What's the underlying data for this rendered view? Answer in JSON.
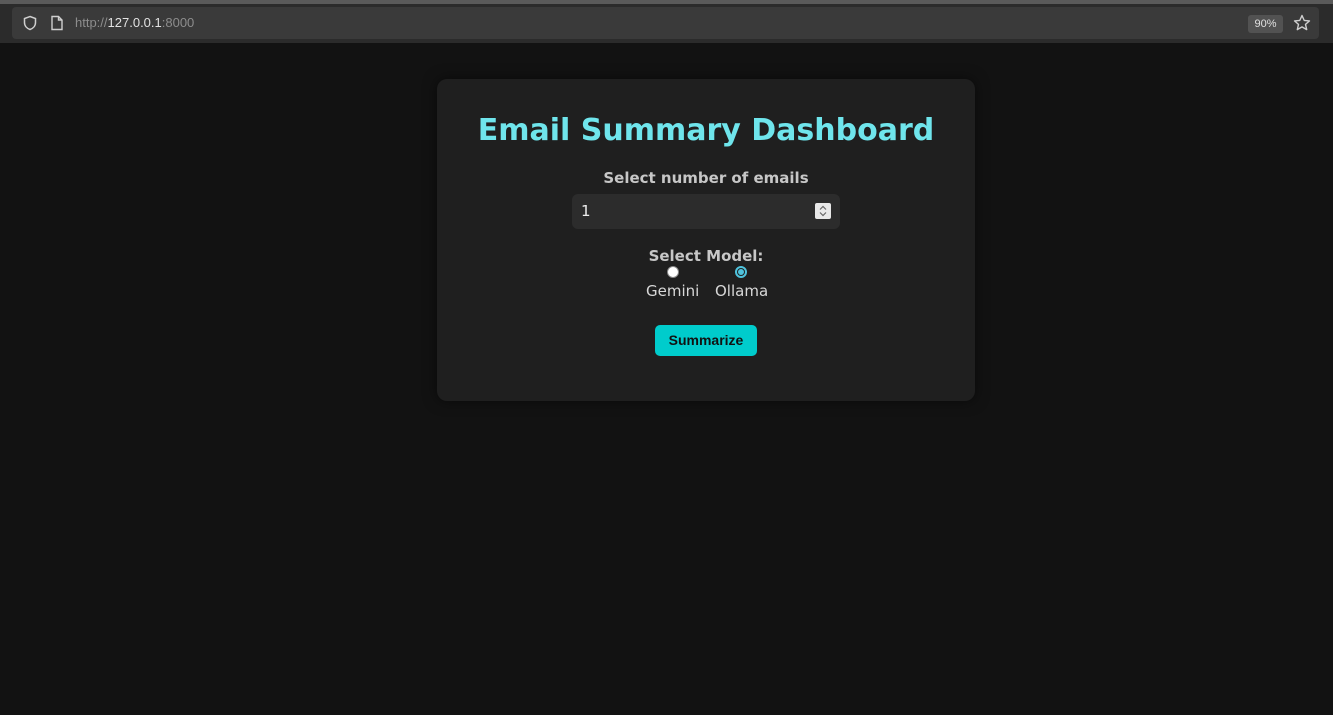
{
  "browser": {
    "url_scheme": "http://",
    "url_host": "127.0.0.1",
    "url_port": ":8000",
    "zoom": "90%"
  },
  "card": {
    "title": "Email Summary Dashboard",
    "count_label": "Select number of emails",
    "count_value": "1",
    "model_label": "Select Model:",
    "models": [
      {
        "label": "Gemini",
        "selected": false
      },
      {
        "label": "Ollama",
        "selected": true
      }
    ],
    "submit_label": "Summarize"
  },
  "colors": {
    "accent": "#00cccc",
    "title": "#6fe5ec",
    "background": "#121212",
    "card": "#1f1f1f"
  },
  "icons": [
    "shield-icon",
    "page-icon",
    "star-icon",
    "spinner-arrows-icon"
  ]
}
